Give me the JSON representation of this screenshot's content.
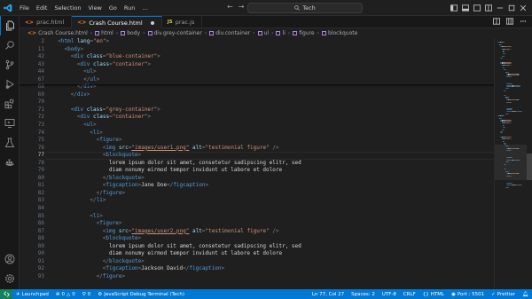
{
  "titlebar": {
    "menu": [
      "File",
      "Edit",
      "Selection",
      "View",
      "Go",
      "Run",
      "…"
    ],
    "search": "Tech",
    "back": "←",
    "forward": "→"
  },
  "tabs": [
    {
      "label": "prac.html",
      "type": "html",
      "active": false,
      "dirty": false
    },
    {
      "label": "Crash Course.html",
      "type": "html",
      "active": true,
      "dirty": true
    },
    {
      "label": "prac.js",
      "type": "js",
      "active": false,
      "dirty": false
    }
  ],
  "breadcrumb": [
    "Crash Course.html",
    "html",
    "body",
    "div.grey-container",
    "div.container",
    "ul",
    "li",
    "figure",
    "blockquote"
  ],
  "editor": {
    "current_line": "77",
    "lines": [
      {
        "n": "2",
        "indent": 2,
        "tokens": [
          [
            "p",
            "<"
          ],
          [
            "tag",
            "html"
          ],
          [
            "txt",
            " "
          ],
          [
            "attr",
            "lang"
          ],
          [
            "p",
            "="
          ],
          [
            "str",
            "\"en\""
          ],
          [
            "p",
            ">"
          ]
        ]
      },
      {
        "n": "11",
        "indent": 4,
        "tokens": [
          [
            "p",
            "<"
          ],
          [
            "tag",
            "body"
          ],
          [
            "p",
            ">"
          ]
        ]
      },
      {
        "n": "42",
        "indent": 6,
        "tokens": [
          [
            "p",
            "<"
          ],
          [
            "tag",
            "div"
          ],
          [
            "txt",
            " "
          ],
          [
            "attr",
            "class"
          ],
          [
            "p",
            "="
          ],
          [
            "str",
            "\"blue-container\""
          ],
          [
            "p",
            ">"
          ]
        ]
      },
      {
        "n": "43",
        "indent": 8,
        "tokens": [
          [
            "p",
            "<"
          ],
          [
            "tag",
            "div"
          ],
          [
            "txt",
            " "
          ],
          [
            "attr",
            "class"
          ],
          [
            "p",
            "="
          ],
          [
            "str",
            "\"container\""
          ],
          [
            "p",
            ">"
          ]
        ]
      },
      {
        "n": "44",
        "indent": 10,
        "tokens": [
          [
            "p",
            "<"
          ],
          [
            "tag",
            "ul"
          ],
          [
            "p",
            ">"
          ]
        ]
      },
      {
        "n": "67",
        "indent": 10,
        "tokens": [
          [
            "p",
            "</"
          ],
          [
            "tag",
            "ul"
          ],
          [
            "p",
            ">"
          ]
        ]
      },
      {
        "n": "68",
        "indent": 8,
        "tokens": [
          [
            "p",
            "</"
          ],
          [
            "tag",
            "div"
          ],
          [
            "p",
            ">"
          ]
        ]
      },
      {
        "n": "69",
        "indent": 6,
        "tokens": [
          [
            "p",
            "</"
          ],
          [
            "tag",
            "div"
          ],
          [
            "p",
            ">"
          ]
        ]
      },
      {
        "n": "70",
        "indent": 0,
        "tokens": []
      },
      {
        "n": "71",
        "indent": 6,
        "tokens": [
          [
            "p",
            "<"
          ],
          [
            "tag",
            "div"
          ],
          [
            "txt",
            " "
          ],
          [
            "attr",
            "class"
          ],
          [
            "p",
            "="
          ],
          [
            "str",
            "\"grey-container\""
          ],
          [
            "p",
            ">"
          ]
        ]
      },
      {
        "n": "72",
        "indent": 8,
        "tokens": [
          [
            "p",
            "<"
          ],
          [
            "tag",
            "div"
          ],
          [
            "txt",
            " "
          ],
          [
            "attr",
            "class"
          ],
          [
            "p",
            "="
          ],
          [
            "str",
            "\"container\""
          ],
          [
            "p",
            ">"
          ]
        ]
      },
      {
        "n": "73",
        "indent": 10,
        "tokens": [
          [
            "p",
            "<"
          ],
          [
            "tag",
            "ul"
          ],
          [
            "p",
            ">"
          ]
        ]
      },
      {
        "n": "74",
        "indent": 12,
        "tokens": [
          [
            "p",
            "<"
          ],
          [
            "tag",
            "li"
          ],
          [
            "p",
            ">"
          ]
        ]
      },
      {
        "n": "75",
        "indent": 14,
        "tokens": [
          [
            "p",
            "<"
          ],
          [
            "tag",
            "figure"
          ],
          [
            "p",
            ">"
          ]
        ]
      },
      {
        "n": "76",
        "indent": 16,
        "tokens": [
          [
            "p",
            "<"
          ],
          [
            "tag",
            "img"
          ],
          [
            "txt",
            " "
          ],
          [
            "attr",
            "src"
          ],
          [
            "p",
            "="
          ],
          [
            "link",
            "\"images/user1.png\""
          ],
          [
            "txt",
            " "
          ],
          [
            "attr",
            "alt"
          ],
          [
            "p",
            "="
          ],
          [
            "str",
            "\"testimonial figure\""
          ],
          [
            "txt",
            " "
          ],
          [
            "p",
            "/>"
          ]
        ]
      },
      {
        "n": "77",
        "indent": 16,
        "tokens": [
          [
            "p",
            "<"
          ],
          [
            "tag",
            "blockquote"
          ],
          [
            "p",
            ">"
          ]
        ]
      },
      {
        "n": "78",
        "indent": 18,
        "tokens": [
          [
            "txt",
            "lorem ipsum dolor sit amet, consetetur sadipscing elitr, sed"
          ]
        ]
      },
      {
        "n": "79",
        "indent": 18,
        "tokens": [
          [
            "txt",
            "diam nonumy eirmod tempor invidunt ut labore et dolore"
          ]
        ]
      },
      {
        "n": "80",
        "indent": 16,
        "tokens": [
          [
            "p",
            "</"
          ],
          [
            "tag",
            "blockquote"
          ],
          [
            "p",
            ">"
          ]
        ]
      },
      {
        "n": "81",
        "indent": 16,
        "tokens": [
          [
            "p",
            "<"
          ],
          [
            "tag",
            "figcaption"
          ],
          [
            "p",
            ">"
          ],
          [
            "txt",
            "Jane Doe"
          ],
          [
            "p",
            "</"
          ],
          [
            "tag",
            "figcaption"
          ],
          [
            "p",
            ">"
          ]
        ]
      },
      {
        "n": "82",
        "indent": 14,
        "tokens": [
          [
            "p",
            "</"
          ],
          [
            "tag",
            "figure"
          ],
          [
            "p",
            ">"
          ]
        ]
      },
      {
        "n": "83",
        "indent": 12,
        "tokens": [
          [
            "p",
            "</"
          ],
          [
            "tag",
            "li"
          ],
          [
            "p",
            ">"
          ]
        ]
      },
      {
        "n": "84",
        "indent": 0,
        "tokens": []
      },
      {
        "n": "85",
        "indent": 12,
        "tokens": [
          [
            "p",
            "<"
          ],
          [
            "tag",
            "li"
          ],
          [
            "p",
            ">"
          ]
        ]
      },
      {
        "n": "86",
        "indent": 14,
        "tokens": [
          [
            "p",
            "<"
          ],
          [
            "tag",
            "figure"
          ],
          [
            "p",
            ">"
          ]
        ]
      },
      {
        "n": "87",
        "indent": 16,
        "tokens": [
          [
            "p",
            "<"
          ],
          [
            "tag",
            "img"
          ],
          [
            "txt",
            " "
          ],
          [
            "attr",
            "src"
          ],
          [
            "p",
            "="
          ],
          [
            "link",
            "\"images/user2.png\""
          ],
          [
            "txt",
            " "
          ],
          [
            "attr",
            "alt"
          ],
          [
            "p",
            "="
          ],
          [
            "str",
            "\"testimonial figure\""
          ],
          [
            "txt",
            " "
          ],
          [
            "p",
            "/>"
          ]
        ]
      },
      {
        "n": "88",
        "indent": 16,
        "tokens": [
          [
            "p",
            "<"
          ],
          [
            "tag",
            "blockquote"
          ],
          [
            "p",
            ">"
          ]
        ]
      },
      {
        "n": "89",
        "indent": 18,
        "tokens": [
          [
            "txt",
            "lorem ipsum dolor sit amet, consetetur sadipscing elitr, sed"
          ]
        ]
      },
      {
        "n": "90",
        "indent": 18,
        "tokens": [
          [
            "txt",
            "diam nonumy eirmod tempor invidunt ut labore et dolore"
          ]
        ]
      },
      {
        "n": "91",
        "indent": 16,
        "tokens": [
          [
            "p",
            "</"
          ],
          [
            "tag",
            "blockquote"
          ],
          [
            "p",
            ">"
          ]
        ]
      },
      {
        "n": "92",
        "indent": 16,
        "tokens": [
          [
            "p",
            "<"
          ],
          [
            "tag",
            "figcaption"
          ],
          [
            "p",
            ">"
          ],
          [
            "txt",
            "Jackson David"
          ],
          [
            "p",
            "</"
          ],
          [
            "tag",
            "figcaption"
          ],
          [
            "p",
            ">"
          ]
        ]
      },
      {
        "n": "93",
        "indent": 14,
        "tokens": [
          [
            "p",
            "</"
          ],
          [
            "tag",
            "figure"
          ],
          [
            "p",
            ">"
          ]
        ]
      }
    ]
  },
  "statusbar": {
    "launchpad": "Launchpad",
    "errors": "0",
    "warnings": "0",
    "ports": "0",
    "debug": "JavaScript Debug Terminal (Tech)",
    "position": "Ln 77, Col 27",
    "spaces": "Spaces: 2",
    "encoding": "UTF-8",
    "eol": "CRLF",
    "language": "HTML",
    "live_server": "Port : 5501",
    "prettier": "Prettier"
  },
  "colors": {
    "accent": "#0078d4",
    "tag": "#569cd6",
    "attr": "#9cdcfe",
    "string": "#ce9178",
    "text": "#d4d4d4"
  }
}
